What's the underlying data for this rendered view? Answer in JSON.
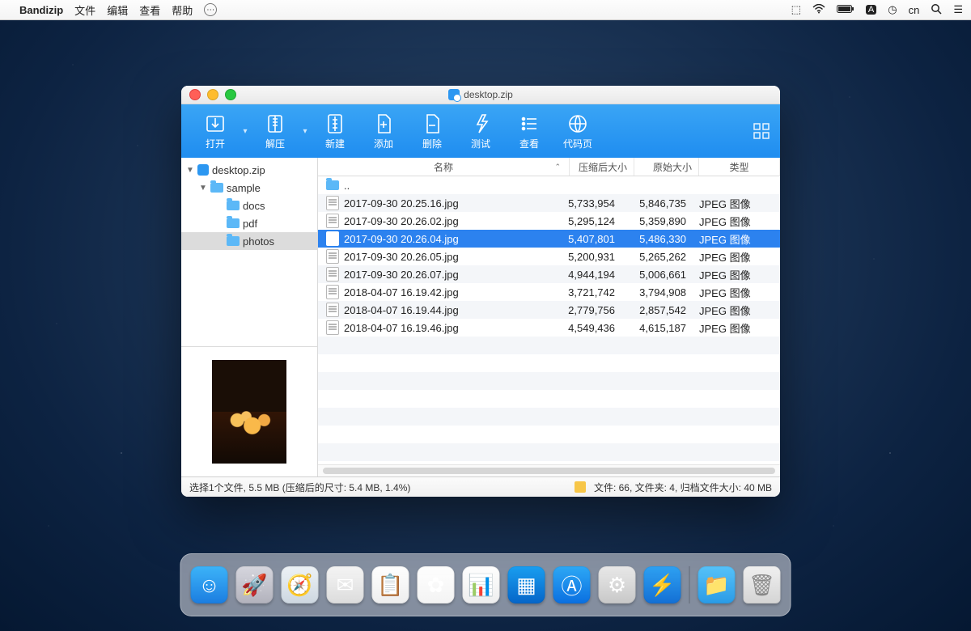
{
  "menubar": {
    "app": "Bandizip",
    "items": [
      "文件",
      "编辑",
      "查看",
      "帮助"
    ],
    "right_input_method": "cn"
  },
  "window": {
    "title": "desktop.zip"
  },
  "toolbar": {
    "open": "打开",
    "extract": "解压",
    "new": "新建",
    "add": "添加",
    "delete": "删除",
    "test": "测试",
    "view": "查看",
    "codepage": "代码页"
  },
  "tree": {
    "root": "desktop.zip",
    "nodes": [
      {
        "label": "sample",
        "depth": 1,
        "expanded": true
      },
      {
        "label": "docs",
        "depth": 2
      },
      {
        "label": "pdf",
        "depth": 2
      },
      {
        "label": "photos",
        "depth": 2,
        "selected": true
      }
    ]
  },
  "columns": {
    "name": "名称",
    "compressed": "压缩后大小",
    "original": "原始大小",
    "type": "类型"
  },
  "parent_label": "..",
  "files": [
    {
      "name": "2017-09-30 20.25.16.jpg",
      "comp": "5,733,954",
      "orig": "5,846,735",
      "type": "JPEG 图像"
    },
    {
      "name": "2017-09-30 20.26.02.jpg",
      "comp": "5,295,124",
      "orig": "5,359,890",
      "type": "JPEG 图像"
    },
    {
      "name": "2017-09-30 20.26.04.jpg",
      "comp": "5,407,801",
      "orig": "5,486,330",
      "type": "JPEG 图像",
      "selected": true
    },
    {
      "name": "2017-09-30 20.26.05.jpg",
      "comp": "5,200,931",
      "orig": "5,265,262",
      "type": "JPEG 图像"
    },
    {
      "name": "2017-09-30 20.26.07.jpg",
      "comp": "4,944,194",
      "orig": "5,006,661",
      "type": "JPEG 图像"
    },
    {
      "name": "2018-04-07 16.19.42.jpg",
      "comp": "3,721,742",
      "orig": "3,794,908",
      "type": "JPEG 图像"
    },
    {
      "name": "2018-04-07 16.19.44.jpg",
      "comp": "2,779,756",
      "orig": "2,857,542",
      "type": "JPEG 图像"
    },
    {
      "name": "2018-04-07 16.19.46.jpg",
      "comp": "4,549,436",
      "orig": "4,615,187",
      "type": "JPEG 图像"
    }
  ],
  "status": {
    "left": "选择1个文件, 5.5 MB (压缩后的尺寸: 5.4 MB, 1.4%)",
    "right": "文件: 66, 文件夹: 4, 归档文件大小: 40 MB"
  },
  "dock": [
    {
      "name": "finder",
      "bg": "linear-gradient(#3db4f9,#1b7de0)",
      "glyph": "☺"
    },
    {
      "name": "launchpad",
      "bg": "linear-gradient(#d7d7df,#b2b2bc)",
      "glyph": "🚀"
    },
    {
      "name": "safari",
      "bg": "linear-gradient(#eef3f7,#cdd7e0)",
      "glyph": "🧭"
    },
    {
      "name": "mail",
      "bg": "linear-gradient(#f5f5f5,#dcdcdc)",
      "glyph": "✉"
    },
    {
      "name": "reminders",
      "bg": "linear-gradient(#fff,#eee)",
      "glyph": "📋"
    },
    {
      "name": "photos",
      "bg": "linear-gradient(#fff,#f3f3f3)",
      "glyph": "✿"
    },
    {
      "name": "numbers",
      "bg": "linear-gradient(#fff,#eee)",
      "glyph": "📊"
    },
    {
      "name": "keynote",
      "bg": "linear-gradient(#1a9ff1,#0565c8)",
      "glyph": "▦"
    },
    {
      "name": "appstore",
      "bg": "linear-gradient(#2ea9f6,#0a6fe0)",
      "glyph": "Ⓐ"
    },
    {
      "name": "settings",
      "bg": "linear-gradient(#e9e9e9,#c8c8c8)",
      "glyph": "⚙"
    },
    {
      "name": "bandizip",
      "bg": "linear-gradient(#2fa2f3,#136fd4)",
      "glyph": "⚡"
    }
  ]
}
